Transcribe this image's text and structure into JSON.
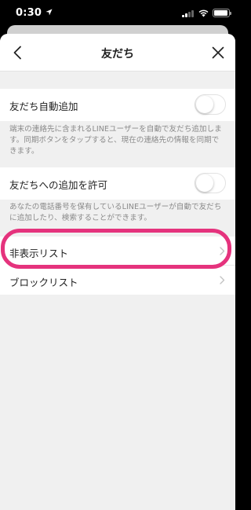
{
  "status_bar": {
    "time": "0:30",
    "location_icon": "location-arrow-icon",
    "signal_icon": "cellular-signal-icon",
    "wifi_icon": "wifi-icon",
    "battery_icon": "battery-icon"
  },
  "nav": {
    "title": "友だち",
    "back_icon": "chevron-left-icon",
    "close_icon": "close-icon"
  },
  "settings": {
    "auto_add": {
      "label": "友だち自動追加",
      "enabled": false,
      "description_line1": "端末の連絡先に含まれるLINEユーザーを自動で友だち追加しま",
      "description_line2": "す。同期ボタンをタップすると、現在の連絡先の情報を同期で",
      "description_line3": "きます。"
    },
    "allow_add": {
      "label": "友だちへの追加を許可",
      "enabled": false,
      "description_line1": "あなたの電話番号を保有しているLINEユーザーが自動で友だち",
      "description_line2": "に追加したり、検索することができます。"
    }
  },
  "lists": [
    {
      "label": "非表示リスト",
      "icon": "chevron-right-icon"
    },
    {
      "label": "ブロックリスト",
      "icon": "chevron-right-icon"
    }
  ],
  "colors": {
    "highlight": "#e5337d",
    "background": "#f0f0f0",
    "status_bar": "#000000"
  }
}
